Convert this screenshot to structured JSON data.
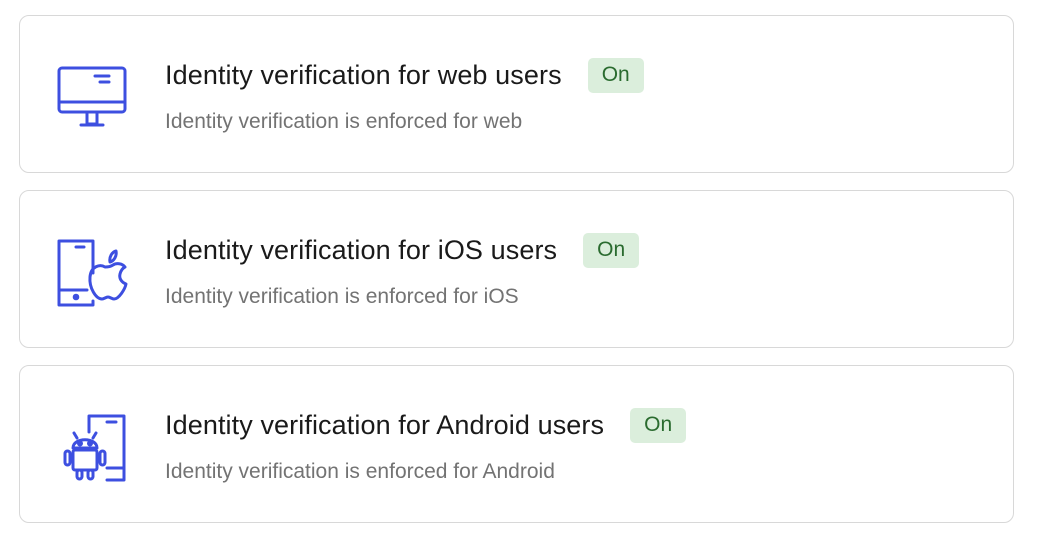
{
  "settings": {
    "items": [
      {
        "icon": "desktop-monitor-icon",
        "title": "Identity verification for web users",
        "status": "On",
        "description": "Identity verification is enforced for web"
      },
      {
        "icon": "ios-phone-apple-icon",
        "title": "Identity verification for iOS users",
        "status": "On",
        "description": "Identity verification is enforced for iOS"
      },
      {
        "icon": "android-phone-robot-icon",
        "title": "Identity verification for Android users",
        "status": "On",
        "description": "Identity verification is enforced for Android"
      }
    ]
  },
  "colors": {
    "icon_blue": "#3d4fe0",
    "badge_bg": "#dbeedc",
    "badge_text": "#2a6b2f"
  }
}
